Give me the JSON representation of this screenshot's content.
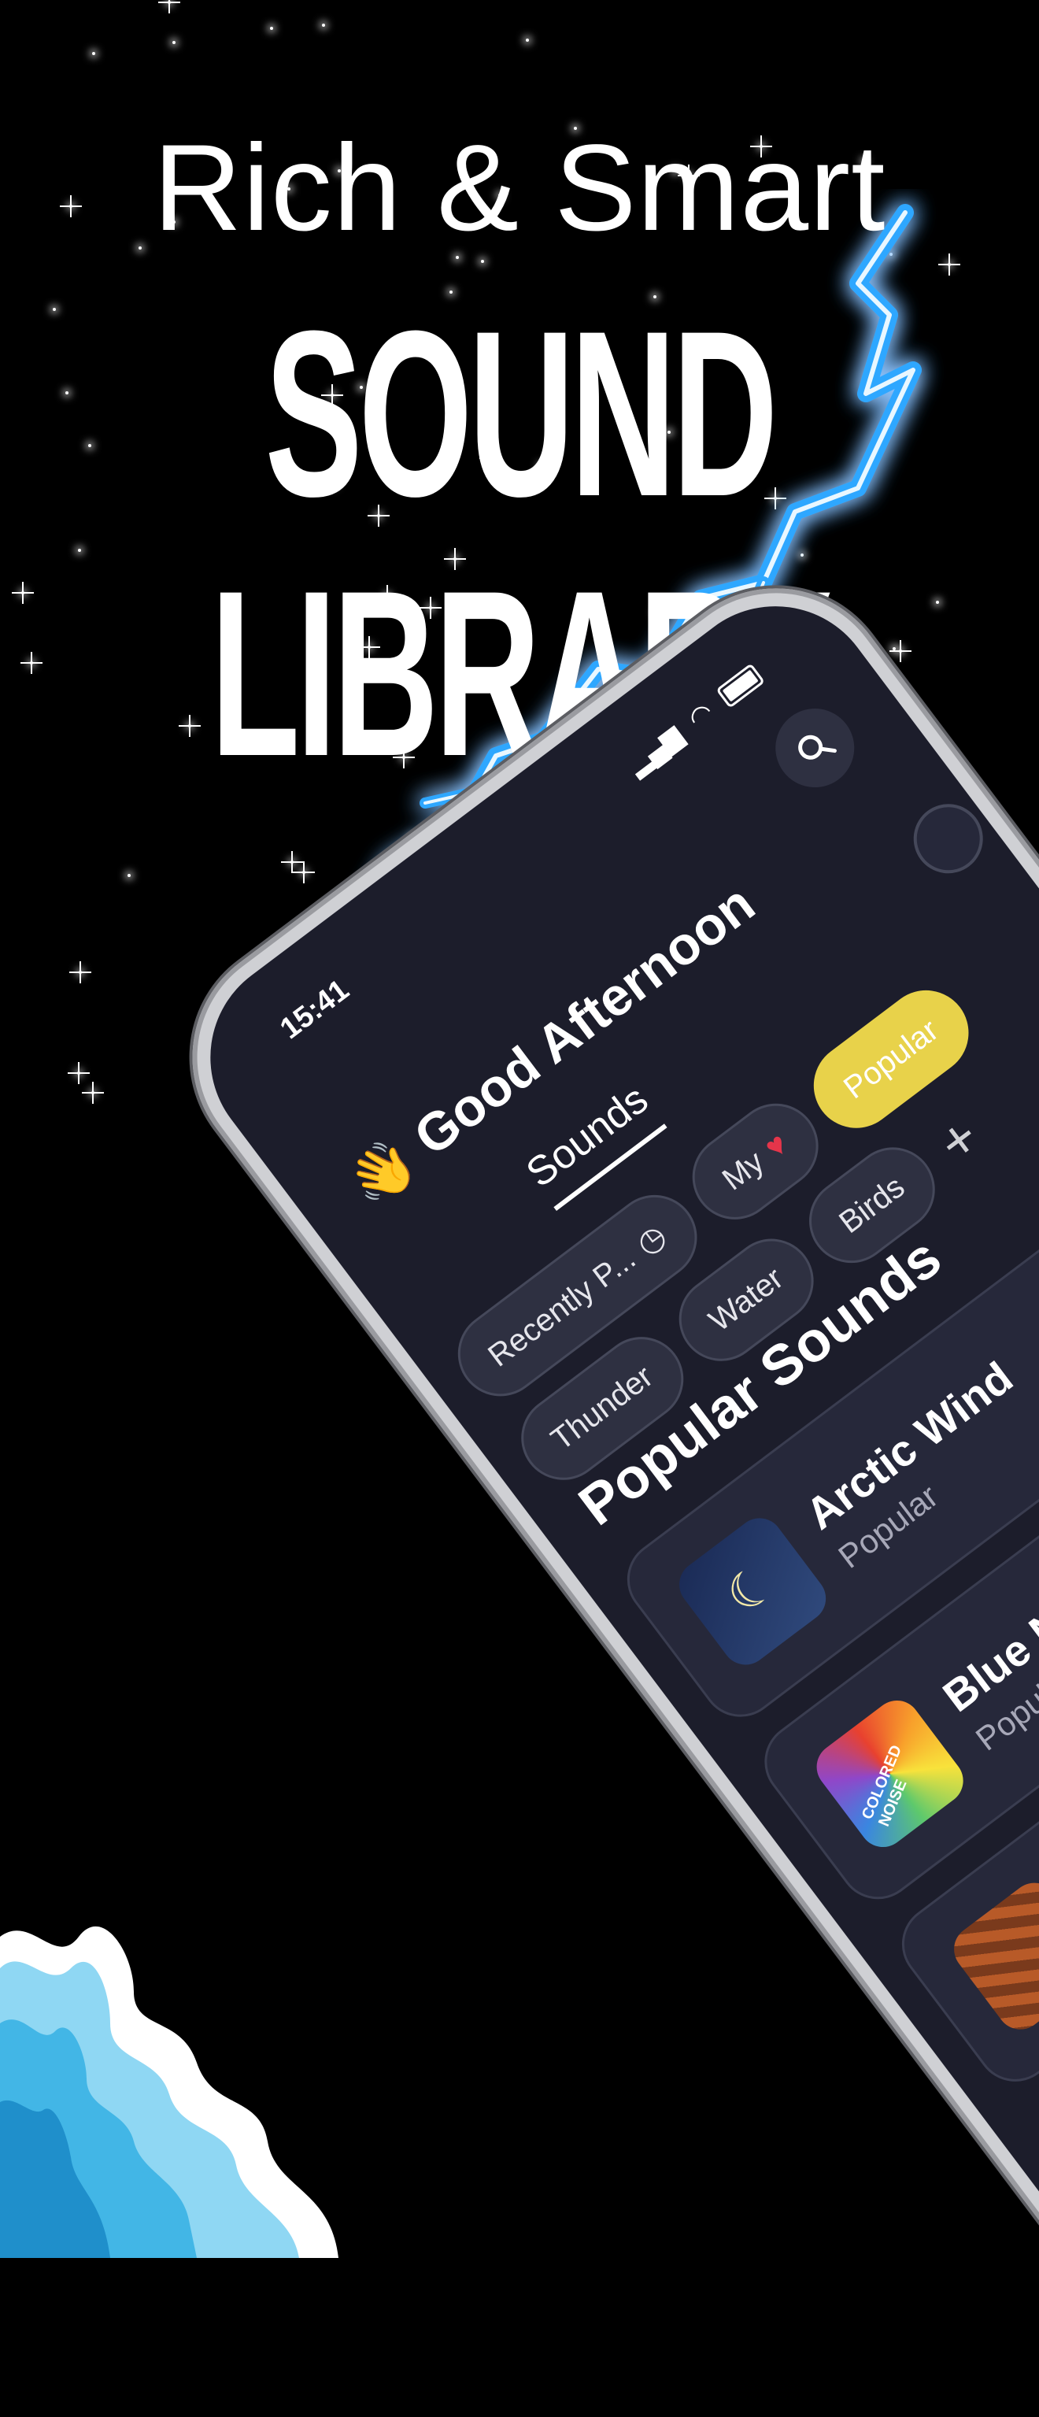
{
  "headline": {
    "line1": "Rich & Smart",
    "line2": "SOUND",
    "line3": "LIBRARY"
  },
  "phone": {
    "status": {
      "time": "15:41"
    },
    "greeting": {
      "emoji": "👋",
      "text": "Good Afternoon"
    },
    "tabs": [
      {
        "label": "Sounds",
        "active": true
      }
    ],
    "chips": [
      {
        "label": "Recently P...",
        "icon": "clock-icon",
        "active": false
      },
      {
        "label": "My",
        "icon": "heart-icon",
        "active": false
      },
      {
        "label": "Popular",
        "active": true
      },
      {
        "label": "Thunder",
        "active": false
      },
      {
        "label": "Water",
        "active": false
      },
      {
        "label": "Birds",
        "active": false
      }
    ],
    "add_label": "+",
    "section_title": "Popular Sounds",
    "sounds": [
      {
        "title": "Arctic Wind",
        "subtitle": "Popular",
        "thumb": "night-sky"
      },
      {
        "title": "Blue Noi",
        "subtitle": "Popular",
        "thumb": "colored-noise",
        "thumb_text": "COLORED NOISE"
      },
      {
        "title": "",
        "subtitle": "",
        "thumb": "brown-waves"
      }
    ]
  },
  "colors": {
    "background": "#000000",
    "screen_bg": "#1c1d2b",
    "chip_bg": "#2e3041",
    "chip_active": "#e8d24a",
    "lightning": "#2ea7ff",
    "wave": "#7fd0f0"
  }
}
